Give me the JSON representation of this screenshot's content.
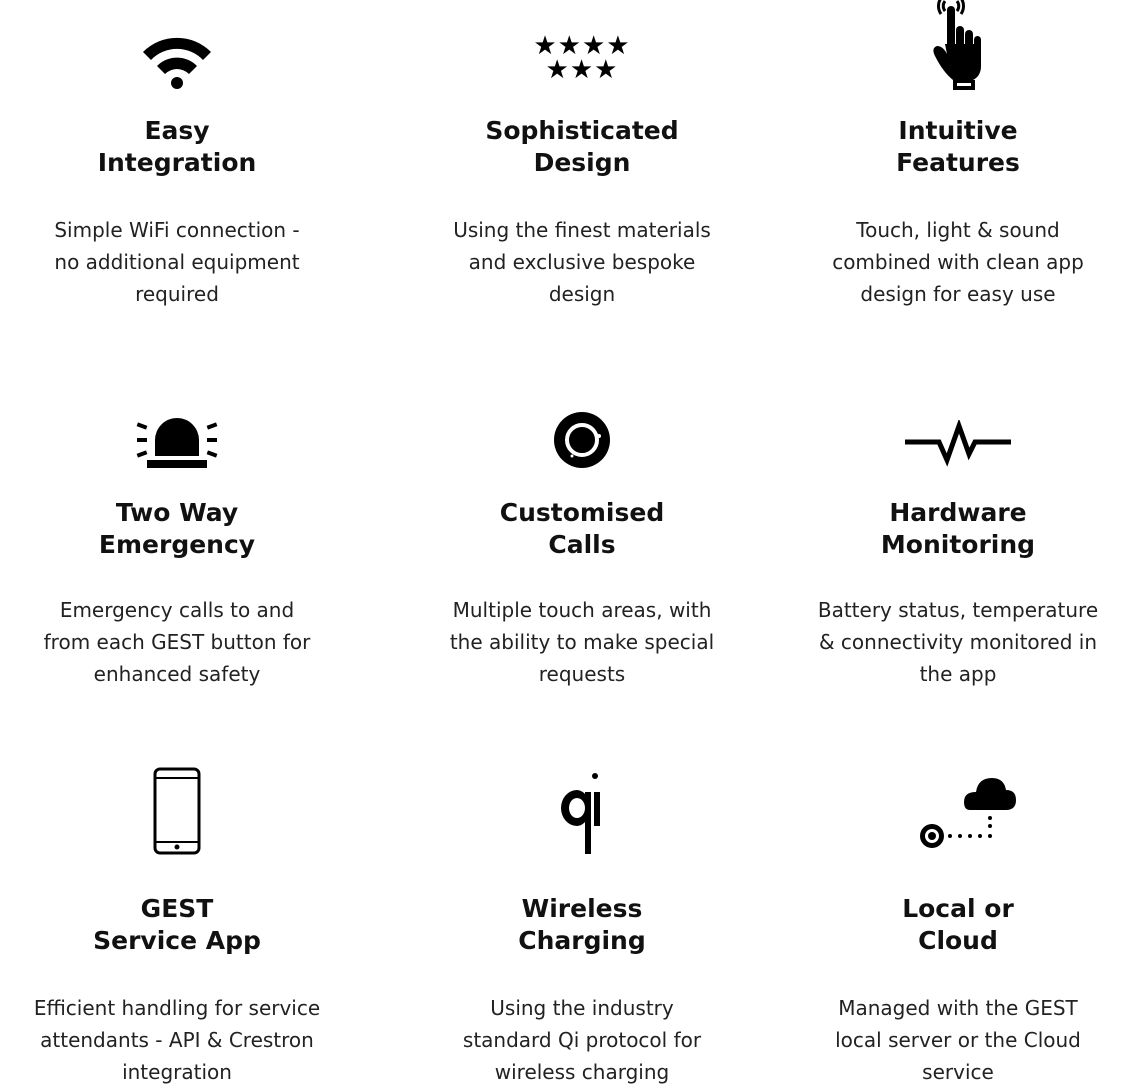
{
  "features": [
    {
      "icon": "wifi-icon",
      "title_lines": [
        "Easy",
        "Integration"
      ],
      "desc_lines": [
        "Simple WiFi connection -",
        "no additional equipment",
        "required"
      ]
    },
    {
      "icon": "stars-icon",
      "stars_row1": "★★★★",
      "stars_row2": "★★★",
      "title_lines": [
        "Sophisticated",
        "Design"
      ],
      "desc_lines": [
        "Using the finest materials",
        "and exclusive bespoke",
        "design"
      ]
    },
    {
      "icon": "touch-hand-icon",
      "title_lines": [
        "Intuitive",
        "Features"
      ],
      "desc_lines": [
        "Touch, light & sound",
        "combined with clean app",
        "design for easy use"
      ]
    },
    {
      "icon": "emergency-siren-icon",
      "title_lines": [
        "Two Way",
        "Emergency"
      ],
      "desc_lines": [
        "Emergency calls to and",
        "from each GEST button for",
        "enhanced safety"
      ]
    },
    {
      "icon": "call-button-icon",
      "title_lines": [
        "Customised",
        "Calls"
      ],
      "desc_lines": [
        "Multiple touch areas, with",
        "the ability to make special",
        "requests"
      ]
    },
    {
      "icon": "pulse-monitor-icon",
      "title_lines": [
        "Hardware",
        "Monitoring"
      ],
      "desc_lines": [
        "Battery status, temperature",
        "& connectivity monitored in",
        "the app"
      ]
    },
    {
      "icon": "smartphone-icon",
      "title_lines": [
        "GEST",
        "Service App"
      ],
      "desc_lines": [
        "Efficient handling for service",
        "attendants - API & Crestron",
        "integration"
      ]
    },
    {
      "icon": "qi-logo-icon",
      "title_lines": [
        "Wireless",
        "Charging"
      ],
      "desc_lines": [
        "Using the industry",
        "standard Qi protocol for",
        "wireless charging"
      ]
    },
    {
      "icon": "local-cloud-icon",
      "title_lines": [
        "Local or",
        "Cloud"
      ],
      "desc_lines": [
        "Managed with the GEST",
        "local server or the Cloud",
        "service"
      ]
    }
  ]
}
